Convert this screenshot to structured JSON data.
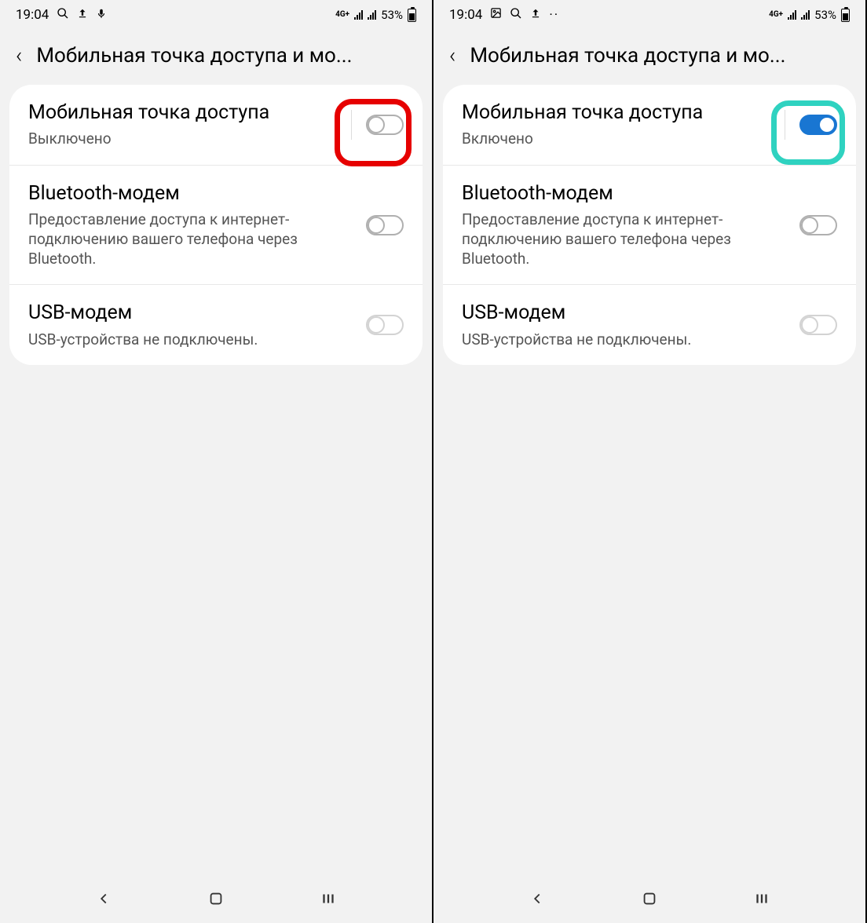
{
  "left": {
    "status": {
      "time": "19:04",
      "net": "4G+",
      "battery": "53%"
    },
    "header": {
      "title": "Мобильная точка доступа и мо..."
    },
    "rows": {
      "hotspot": {
        "title": "Мобильная точка доступа",
        "sub": "Выключено"
      },
      "bluetooth": {
        "title": "Bluetooth-модем",
        "sub": "Предоставление доступа к интернет-подключению вашего телефона через Bluetooth."
      },
      "usb": {
        "title": "USB-модем",
        "sub": "USB-устройства не подключены."
      }
    },
    "highlight_color": "red",
    "hotspot_on": false
  },
  "right": {
    "status": {
      "time": "19:04",
      "net": "4G+",
      "battery": "53%"
    },
    "header": {
      "title": "Мобильная точка доступа и мо..."
    },
    "rows": {
      "hotspot": {
        "title": "Мобильная точка доступа",
        "sub": "Включено"
      },
      "bluetooth": {
        "title": "Bluetooth-модем",
        "sub": "Предоставление доступа к интернет-подключению вашего телефона через Bluetooth."
      },
      "usb": {
        "title": "USB-модем",
        "sub": "USB-устройства не подключены."
      }
    },
    "highlight_color": "teal",
    "hotspot_on": true
  }
}
